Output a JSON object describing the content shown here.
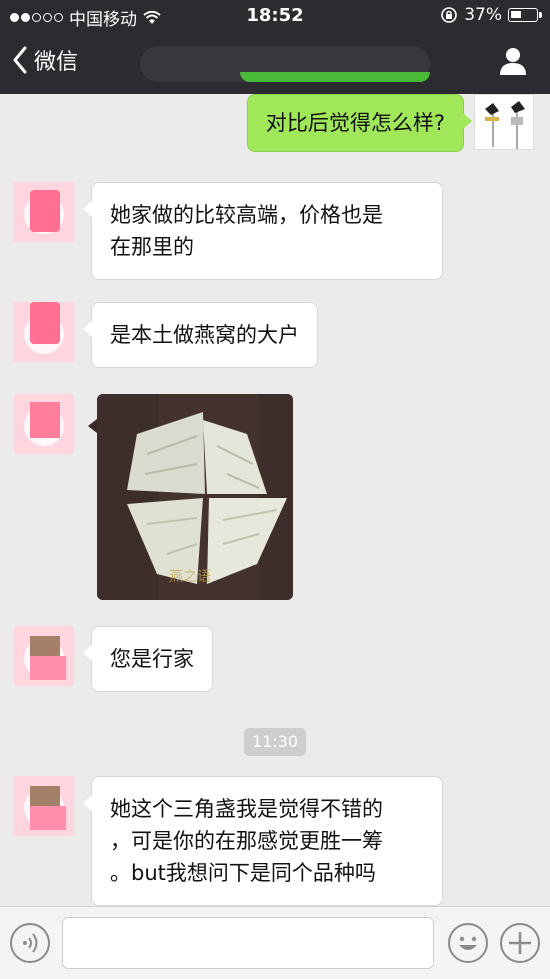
{
  "status_bar": {
    "carrier": "中国移动",
    "time": "18:52",
    "battery_pct": "37%"
  },
  "nav": {
    "back_label": "微信"
  },
  "messages": [
    {
      "from": "me",
      "text": "对比后觉得怎么样?"
    },
    {
      "from": "other",
      "lines": [
        "她家做的比较高端，价格也是",
        "在那里的"
      ]
    },
    {
      "from": "other",
      "text": "是本土做燕窝的大户"
    },
    {
      "from": "other",
      "type": "image",
      "image_text": "燕之语"
    },
    {
      "from": "other",
      "text": "您是行家"
    },
    {
      "type": "time",
      "text": "11:30"
    },
    {
      "from": "other",
      "lines": [
        "她这个三角盏我是觉得不错的",
        "，可是你的在那感觉更胜一筹",
        "。but我想问下是同个品种吗"
      ]
    }
  ],
  "colors": {
    "nav_bg": "#2c2c30",
    "chat_bg": "#ebebeb",
    "outgoing_bubble": "#a0e75a",
    "incoming_bubble": "#ffffff"
  },
  "icons": [
    "chevron-left-icon",
    "profile-icon",
    "voice-icon",
    "emoji-icon",
    "plus-icon",
    "wifi-icon",
    "lock-rotation-icon"
  ]
}
